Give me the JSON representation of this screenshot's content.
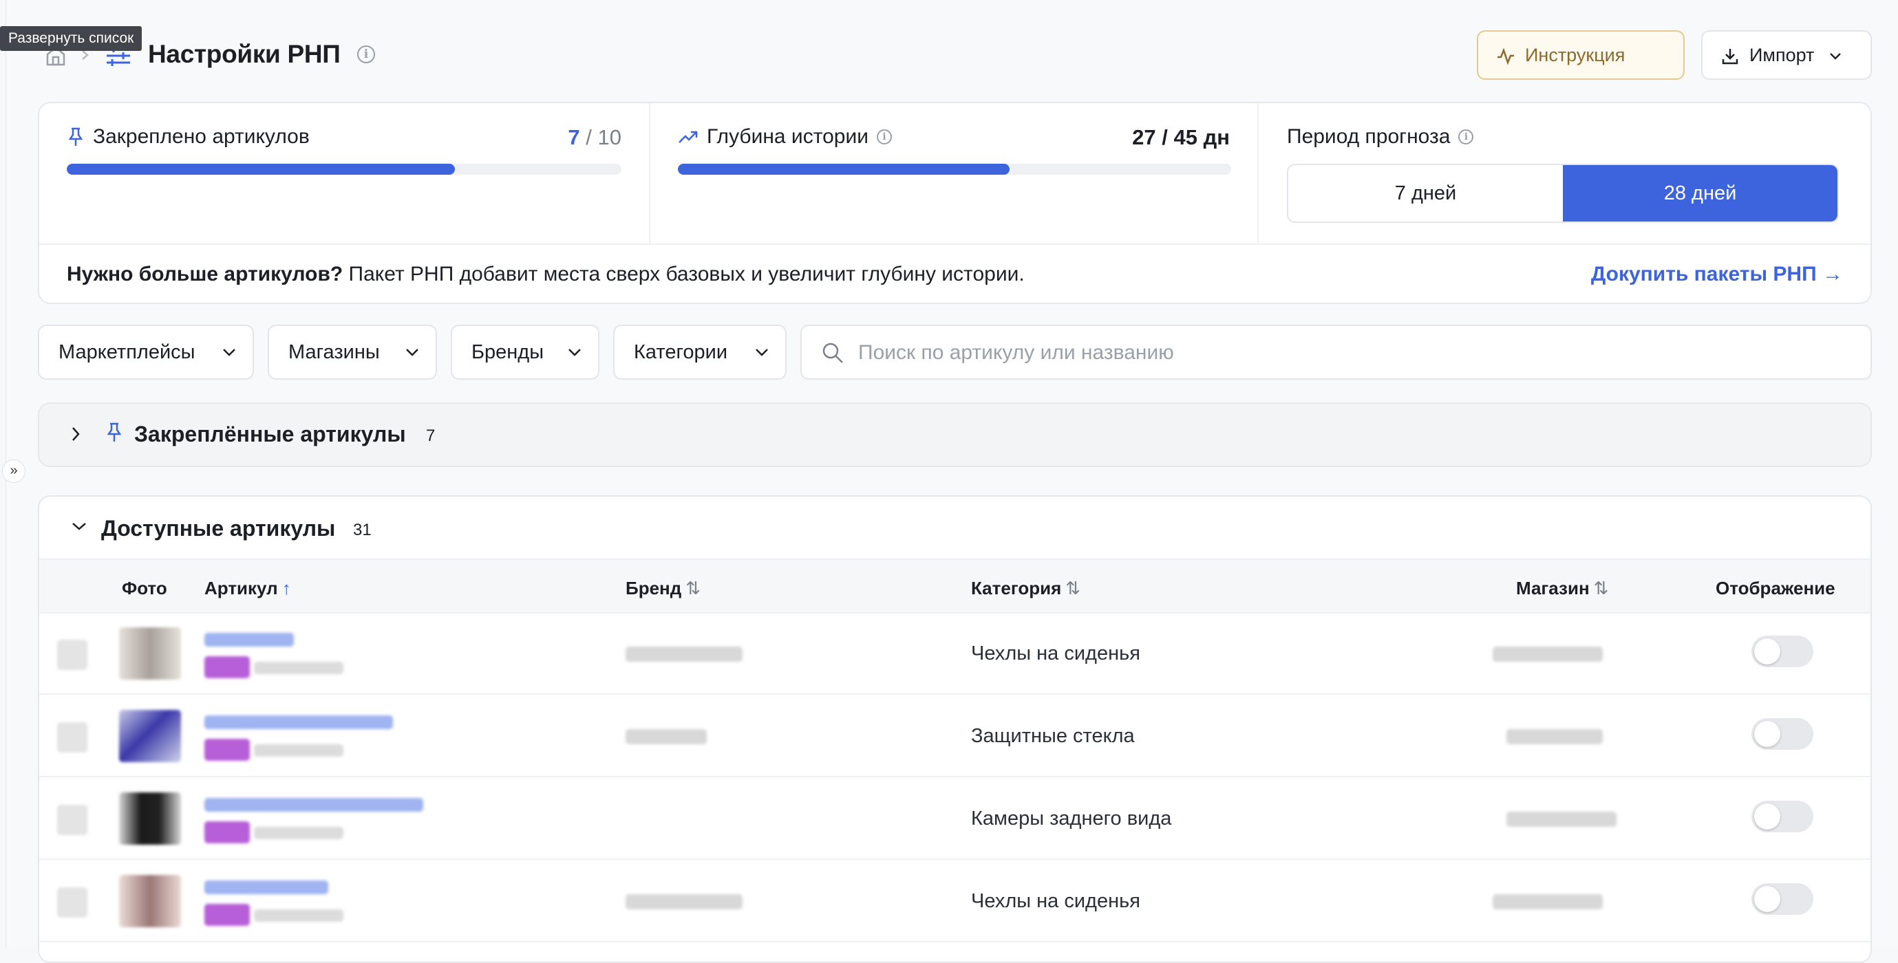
{
  "tooltip": "Развернуть список",
  "expander_glyph": "»",
  "header": {
    "title": "Настройки РНП",
    "guide_label": "Инструкция",
    "import_label": "Импорт"
  },
  "stats": {
    "pinned_label": "Закреплено артикулов",
    "pinned_value": "7",
    "pinned_total": "/ 10",
    "pinned_fraction": 0.7,
    "history_label": "Глубина истории",
    "history_value": "27 / 45 дн",
    "history_fraction": 0.6,
    "forecast_label": "Период прогноза",
    "forecast_options": [
      "7 дней",
      "28 дней"
    ],
    "forecast_selected": "28 дней"
  },
  "promo": {
    "bold": "Нужно больше артикулов?",
    "text": " Пакет РНП добавит места сверх базовых и увеличит глубину истории.",
    "link": "Докупить пакеты РНП →"
  },
  "filters": {
    "marketplaces": "Маркетплейсы",
    "stores": "Магазины",
    "brands": "Бренды",
    "categories": "Категории",
    "search_placeholder": "Поиск по артикулу или названию"
  },
  "pinned_section": {
    "title": "Закреплённые артикулы",
    "count": "7"
  },
  "available_section": {
    "title": "Доступные артикулы",
    "count": "31"
  },
  "table": {
    "columns": [
      "Фото",
      "Артикул",
      "Бренд",
      "Категория",
      "Магазин",
      "Отображение"
    ],
    "sort_asc": "↑",
    "sort_both": "⇅",
    "rows": [
      {
        "category": "Чехлы на сиденья",
        "enabled": false
      },
      {
        "category": "Защитные стекла",
        "enabled": false
      },
      {
        "category": "Камеры заднего вида",
        "enabled": false
      },
      {
        "category": "Чехлы на сиденья",
        "enabled": false
      }
    ]
  },
  "colors": {
    "accent": "#3d63dd",
    "guide_border": "#e7c98f"
  }
}
